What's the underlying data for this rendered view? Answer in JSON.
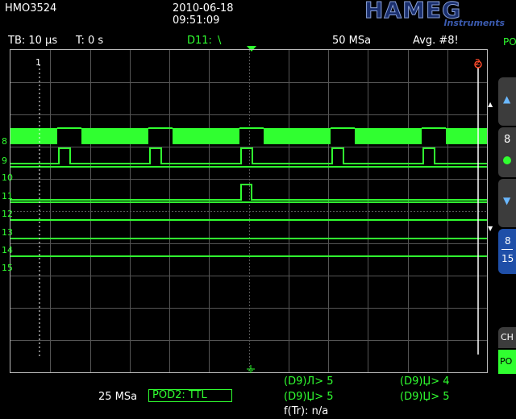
{
  "header": {
    "model": "HMO3524",
    "date": "2010-06-18",
    "time": "09:51:09",
    "logo_main": "HAMEG",
    "logo_sub": "Instruments"
  },
  "status_bar": {
    "timebase": "TB: 10 µs",
    "trigger_time": "T: 0 s",
    "trigger_source": "D11:",
    "trigger_slope": "\\",
    "sample_rate": "50 MSa",
    "acquisition": "Avg. #8!"
  },
  "side_panel": {
    "pod": "POD2",
    "up_icon": "triangle-up",
    "ch_number": "8",
    "down_icon": "triangle-down",
    "range_top": "8",
    "range_bottom": "15",
    "ch_label": "CH",
    "po_label": "PO"
  },
  "cursors": {
    "cursor1_label": "1",
    "cursor2_label": "2"
  },
  "channels": [
    {
      "label": "8"
    },
    {
      "label": "9"
    },
    {
      "label": "10"
    },
    {
      "label": "11"
    },
    {
      "label": "12"
    },
    {
      "label": "13"
    },
    {
      "label": "14"
    },
    {
      "label": "15"
    }
  ],
  "footer": {
    "sample_rate": "25 MSa",
    "pod_setting": "POD2: TTL",
    "trig1": "(D9)Л> 5",
    "trig2": "(D9)Џ> 5",
    "trig3": "(D9)Џ> 4",
    "trig4": "(D9)Џ> 5",
    "freq": "f(Tr): n/a"
  },
  "colors": {
    "trace": "#30ff30",
    "grid": "#555555",
    "cursor2": "#ff4a2a",
    "side_blue": "#1f4fa8",
    "side_gray": "#3c3c3c"
  }
}
